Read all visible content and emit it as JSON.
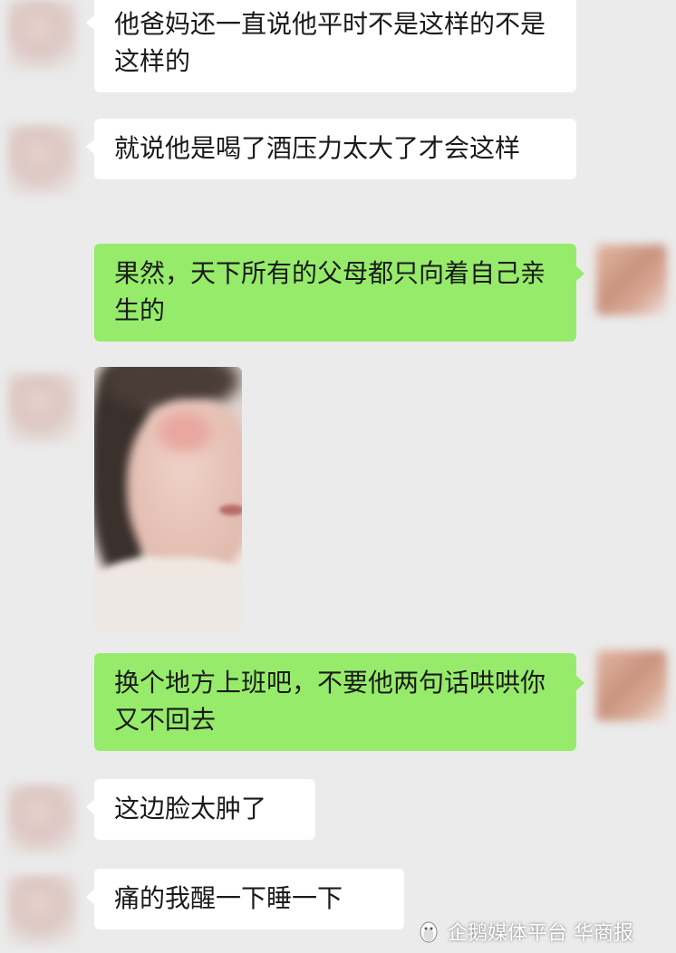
{
  "messages": [
    {
      "side": "left",
      "text": "他爸妈还一直说他平时不是这样的不是这样的"
    },
    {
      "side": "left",
      "text": "就说他是喝了酒压力太大了才会这样"
    },
    {
      "side": "right",
      "text": "果然，天下所有的父母都只向着自己亲生的"
    },
    {
      "side": "left",
      "type": "image",
      "content": "blurred-face-photo"
    },
    {
      "side": "right",
      "text": "换个地方上班吧，不要他两句话哄哄你又不回去"
    },
    {
      "side": "left",
      "text": "这边脸太肿了"
    },
    {
      "side": "left",
      "text": "痛的我醒一下睡一下"
    }
  ],
  "watermark": {
    "text": "企鹅媒体平台 华商报",
    "icon": "penguin-logo"
  },
  "colors": {
    "background": "#ebebeb",
    "incoming_bubble": "#ffffff",
    "outgoing_bubble": "#96ec6a",
    "text": "#1a1a1a"
  }
}
